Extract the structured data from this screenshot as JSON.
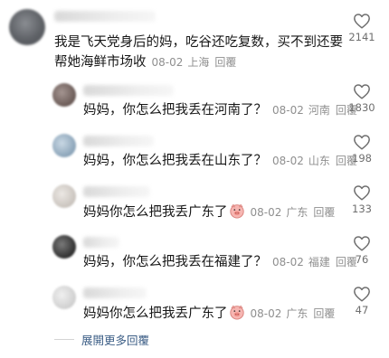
{
  "main_comment": {
    "text": "我是飞天党身后的妈，吃谷还吃复数，买不到还要帮她海鲜市场收",
    "date": "08-02",
    "location": "上海",
    "reply_label": "回覆",
    "likes": "2141"
  },
  "replies": [
    {
      "text": "妈妈，你怎么把我丢在河南了？",
      "emoji": "",
      "date": "08-02",
      "location": "河南",
      "reply_label": "回覆",
      "likes": "1830",
      "avatar_color": "#7a6a66"
    },
    {
      "text": "妈妈，你怎么把我丢在山东了？",
      "emoji": "",
      "date": "08-02",
      "location": "山东",
      "reply_label": "回覆",
      "likes": "198",
      "avatar_color": "#9fb4c6"
    },
    {
      "text": "妈妈你怎么把我丢广东了",
      "emoji": "pig-face",
      "date": "08-02",
      "location": "广东",
      "reply_label": "回覆",
      "likes": "133",
      "avatar_color": "#d9d4cf"
    },
    {
      "text": "妈妈，你怎么把我丢在福建了？",
      "emoji": "",
      "date": "08-02",
      "location": "福建",
      "reply_label": "回覆",
      "likes": "76",
      "avatar_color": "#3d3d3d"
    },
    {
      "text": "妈妈你怎么把我丢广东了",
      "emoji": "pig-face",
      "date": "08-02",
      "location": "广东",
      "reply_label": "回覆",
      "likes": "47",
      "avatar_color": "#d5d5d5"
    }
  ],
  "expand_label": "展開更多回覆"
}
